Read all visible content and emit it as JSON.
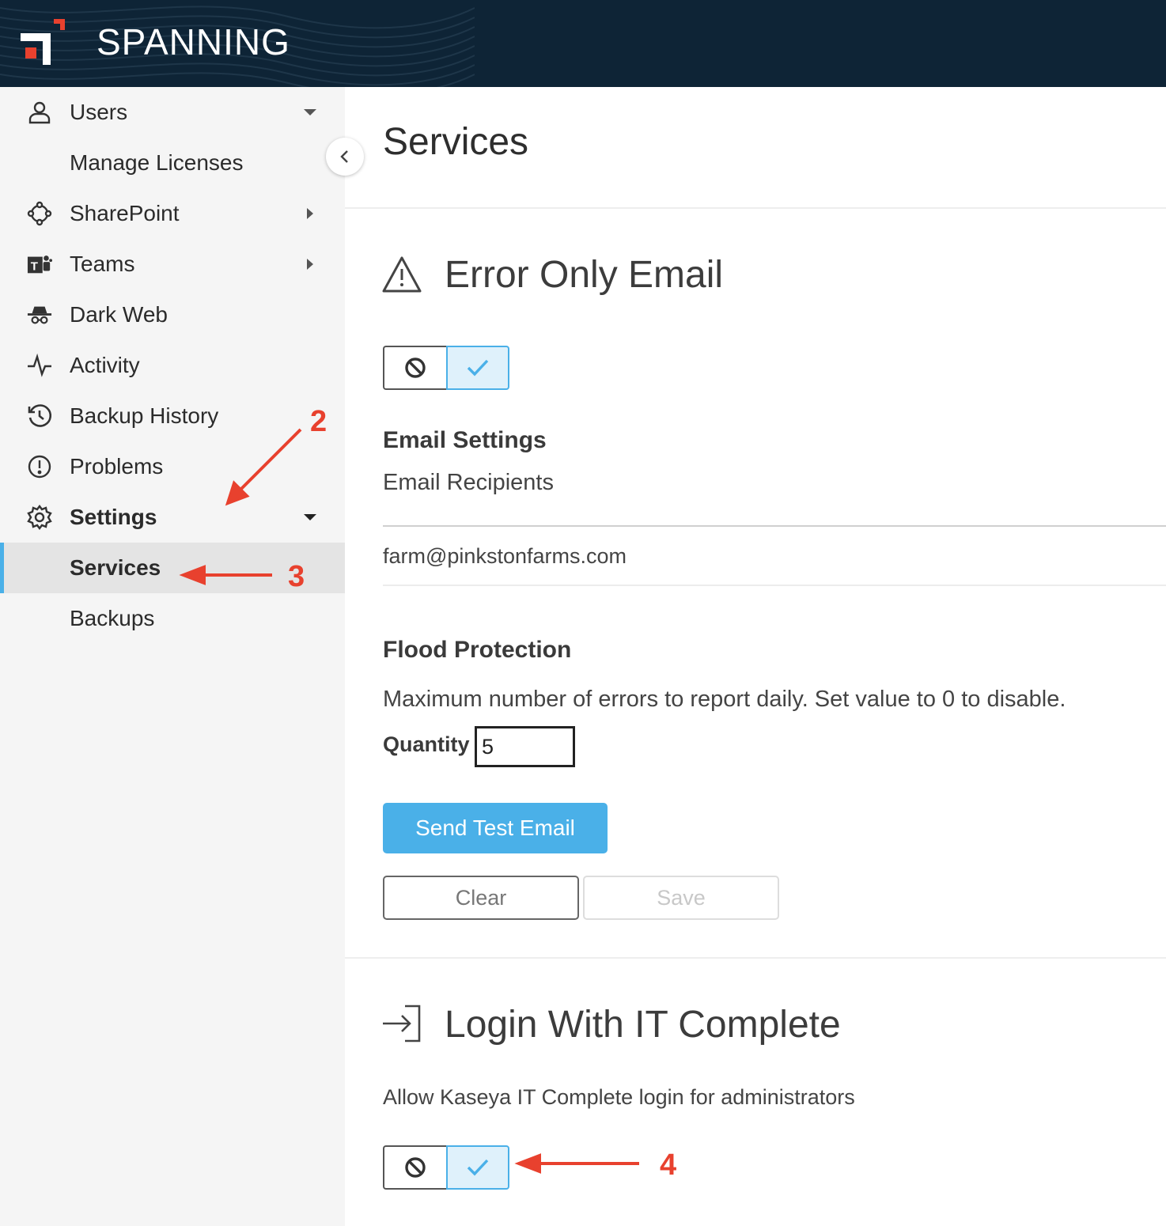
{
  "header": {
    "brand": "SPANNING"
  },
  "sidebar": {
    "items": [
      {
        "label": "Users",
        "icon": "user-icon",
        "caret": "down"
      },
      {
        "label": "Manage Licenses"
      },
      {
        "label": "SharePoint",
        "icon": "sharepoint-icon",
        "caret": "right"
      },
      {
        "label": "Teams",
        "icon": "teams-icon",
        "caret": "right"
      },
      {
        "label": "Dark Web",
        "icon": "spy-icon"
      },
      {
        "label": "Activity",
        "icon": "activity-icon"
      },
      {
        "label": "Backup History",
        "icon": "history-icon"
      },
      {
        "label": "Problems",
        "icon": "alert-circle-icon"
      },
      {
        "label": "Settings",
        "icon": "gear-icon",
        "caret": "down"
      },
      {
        "label": "Services",
        "active": true
      },
      {
        "label": "Backups"
      }
    ]
  },
  "main": {
    "title": "Services",
    "error_email": {
      "title": "Error Only Email",
      "icon": "warning-triangle-icon",
      "enabled": true,
      "email_settings_heading": "Email Settings",
      "recipients_label": "Email Recipients",
      "recipient": "farm@pinkstonfarms.com",
      "flood_heading": "Flood Protection",
      "flood_description": "Maximum number of errors to report daily. Set value to 0 to disable.",
      "quantity_label": "Quantity",
      "quantity_value": "5",
      "send_test_label": "Send Test Email",
      "clear_label": "Clear",
      "save_label": "Save"
    },
    "it_complete": {
      "title": "Login With IT Complete",
      "icon": "login-icon",
      "description": "Allow Kaseya IT Complete login for administrators",
      "enabled": true
    }
  },
  "annotations": {
    "a2": "2",
    "a3": "3",
    "a4": "4"
  },
  "colors": {
    "header_bg": "#0e2436",
    "accent": "#4ab0e8",
    "annotation": "#e8412e",
    "logo_red": "#e8412e"
  }
}
